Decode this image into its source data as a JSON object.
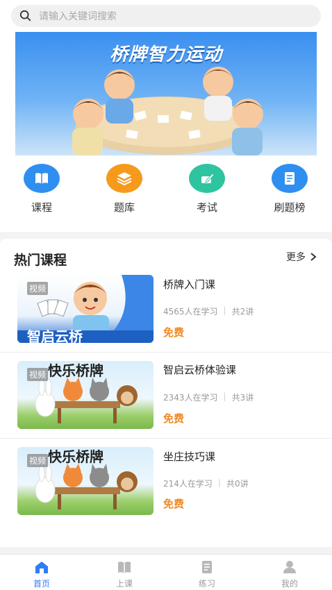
{
  "search": {
    "placeholder": "请输入关键词搜索",
    "icon": "search-icon"
  },
  "banner": {
    "title": "桥牌智力运动"
  },
  "quick_entries": [
    {
      "label": "课程",
      "icon": "book-icon",
      "color": "#2f8ff0"
    },
    {
      "label": "题库",
      "icon": "layers-icon",
      "color": "#f59a1b"
    },
    {
      "label": "考试",
      "icon": "pencil-icon",
      "color": "#2ec4a0"
    },
    {
      "label": "刷题榜",
      "icon": "list-icon",
      "color": "#2f8ff0"
    }
  ],
  "hot_courses": {
    "title": "热门课程",
    "more_label": "更多",
    "items": [
      {
        "tag": "视频",
        "title": "桥牌入门课",
        "learners": "4565人在学习",
        "lessons": "共2讲",
        "price": "免费",
        "thumb_text": "智启云桥"
      },
      {
        "tag": "视频",
        "title": "智启云桥体验课",
        "learners": "2343人在学习",
        "lessons": "共3讲",
        "price": "免费",
        "thumb_text": "快乐桥牌"
      },
      {
        "tag": "视频",
        "title": "坐庄技巧课",
        "learners": "214人在学习",
        "lessons": "共0讲",
        "price": "免费",
        "thumb_text": "快乐桥牌"
      }
    ]
  },
  "tabbar": [
    {
      "label": "首页",
      "icon": "home-icon",
      "active": true
    },
    {
      "label": "上课",
      "icon": "open-book-icon",
      "active": false
    },
    {
      "label": "练习",
      "icon": "document-icon",
      "active": false
    },
    {
      "label": "我的",
      "icon": "user-icon",
      "active": false
    }
  ],
  "colors": {
    "accent": "#2f7cf6",
    "price": "#f08a24"
  }
}
